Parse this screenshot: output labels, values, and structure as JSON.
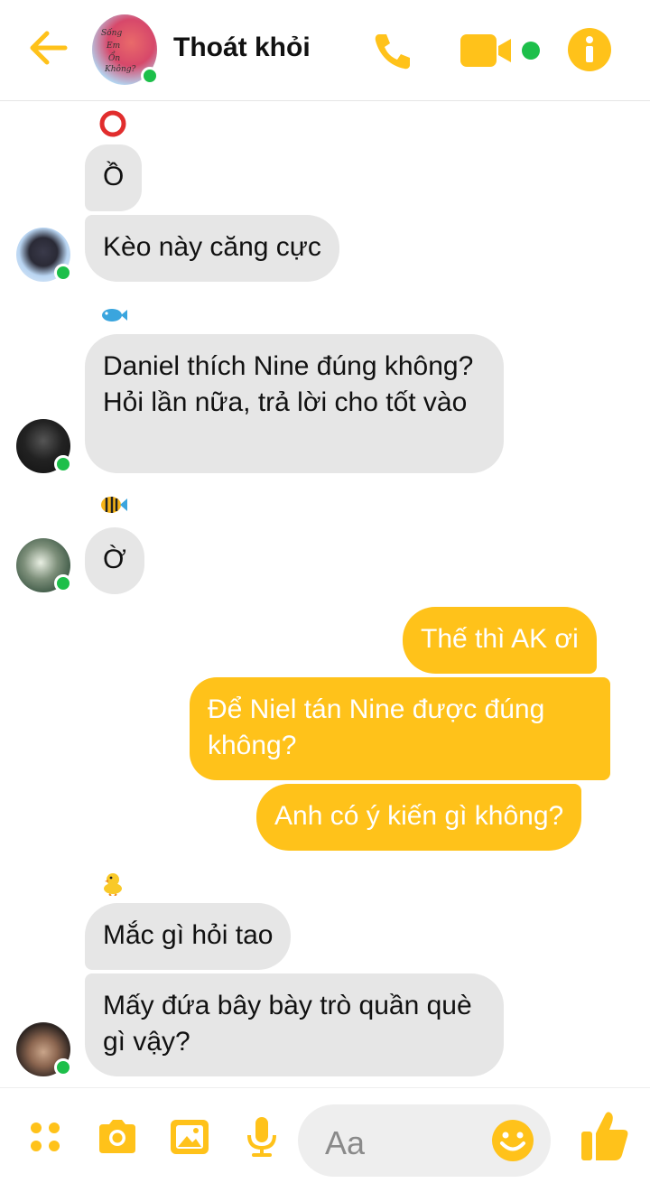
{
  "theme": {
    "accent": "#ffc21a",
    "incoming_bubble": "#e6e6e6",
    "online": "#1dbf4a"
  },
  "header": {
    "title": "Thoát khỏi",
    "avatar_text": [
      "Sống",
      "Em",
      "Ổn",
      "Không?"
    ],
    "icons": [
      "back-arrow-icon",
      "phone-icon",
      "video-camera-icon",
      "info-icon"
    ]
  },
  "messages": [
    {
      "id": "m1",
      "direction": "in",
      "text": "Ồ"
    },
    {
      "id": "m2",
      "direction": "in",
      "text": "Kèo này căng cực"
    },
    {
      "id": "m3",
      "direction": "in",
      "text": "Daniel thích Nine đúng không? Hỏi lần nữa, trả lời cho tốt vào"
    },
    {
      "id": "m4",
      "direction": "in",
      "text": "Ờ"
    },
    {
      "id": "m5",
      "direction": "out",
      "text": "Thế thì AK ơi"
    },
    {
      "id": "m6",
      "direction": "out",
      "text": "Để Niel tán Nine được đúng không?"
    },
    {
      "id": "m7",
      "direction": "out",
      "text": "Anh có ý kiến gì không?"
    },
    {
      "id": "m8",
      "direction": "in",
      "text": "Mắc gì hỏi tao"
    },
    {
      "id": "m9",
      "direction": "in",
      "text": "Mấy đứa bây bày trò quần què gì vậy?"
    }
  ],
  "sender_emojis": [
    "red-circle-emoji",
    "fish-emoji",
    "tropical-fish-emoji",
    "baby-chick-emoji"
  ],
  "composer": {
    "placeholder": "Aa",
    "icons": [
      "apps-icon",
      "camera-icon",
      "gallery-icon",
      "microphone-icon",
      "emoji-icon",
      "thumbs-up-icon"
    ]
  }
}
